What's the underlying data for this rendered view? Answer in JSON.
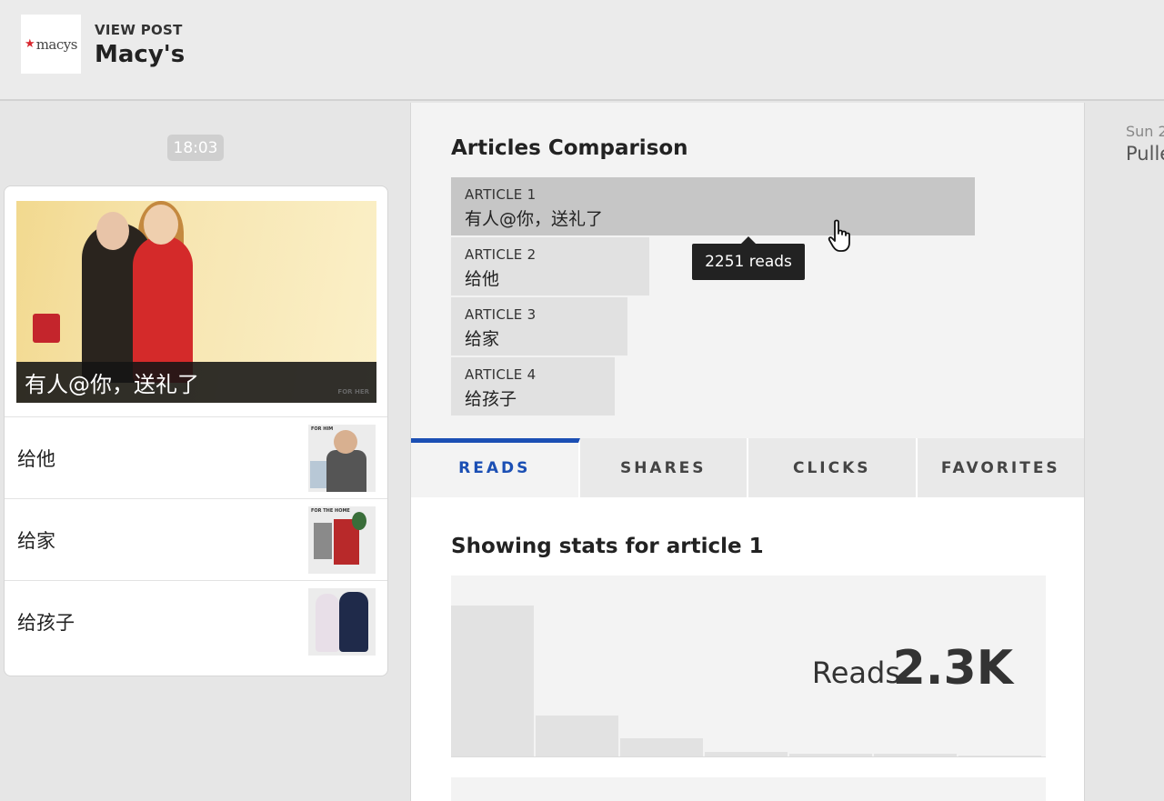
{
  "header": {
    "logo_text": "macys",
    "subtitle": "VIEW POST",
    "title": "Macy's"
  },
  "post": {
    "time": "18:03",
    "hero_caption": "有人@你，送礼了",
    "hero_tag": "FOR HER",
    "items": [
      {
        "label": "给他",
        "thumb_tag": "FOR HIM"
      },
      {
        "label": "给家",
        "thumb_tag": "FOR THE HOME"
      },
      {
        "label": "给孩子",
        "thumb_tag": ""
      }
    ]
  },
  "comparison": {
    "title": "Articles Comparison",
    "articles": [
      {
        "name": "ARTICLE 1",
        "title": "有人@你，送礼了",
        "reads": 2251
      },
      {
        "name": "ARTICLE 2",
        "title": "给他",
        "reads": 850
      },
      {
        "name": "ARTICLE 3",
        "title": "给家",
        "reads": 760
      },
      {
        "name": "ARTICLE 4",
        "title": "给孩子",
        "reads": 705
      }
    ],
    "tooltip": "2251 reads"
  },
  "tabs": [
    {
      "label": "READS",
      "active": true
    },
    {
      "label": "SHARES",
      "active": false
    },
    {
      "label": "CLICKS",
      "active": false
    },
    {
      "label": "FAVORITES",
      "active": false
    }
  ],
  "stats": {
    "title": "Showing stats for article 1",
    "metric_label": "Reads",
    "metric_value": "2.3K",
    "histogram": [
      100,
      27,
      12,
      3,
      2,
      1,
      0
    ]
  },
  "right_panel": {
    "date": "Sun 2",
    "name": "Pulle"
  },
  "colors": {
    "accent": "#1b4fb4",
    "brand_red": "#d8262e"
  }
}
